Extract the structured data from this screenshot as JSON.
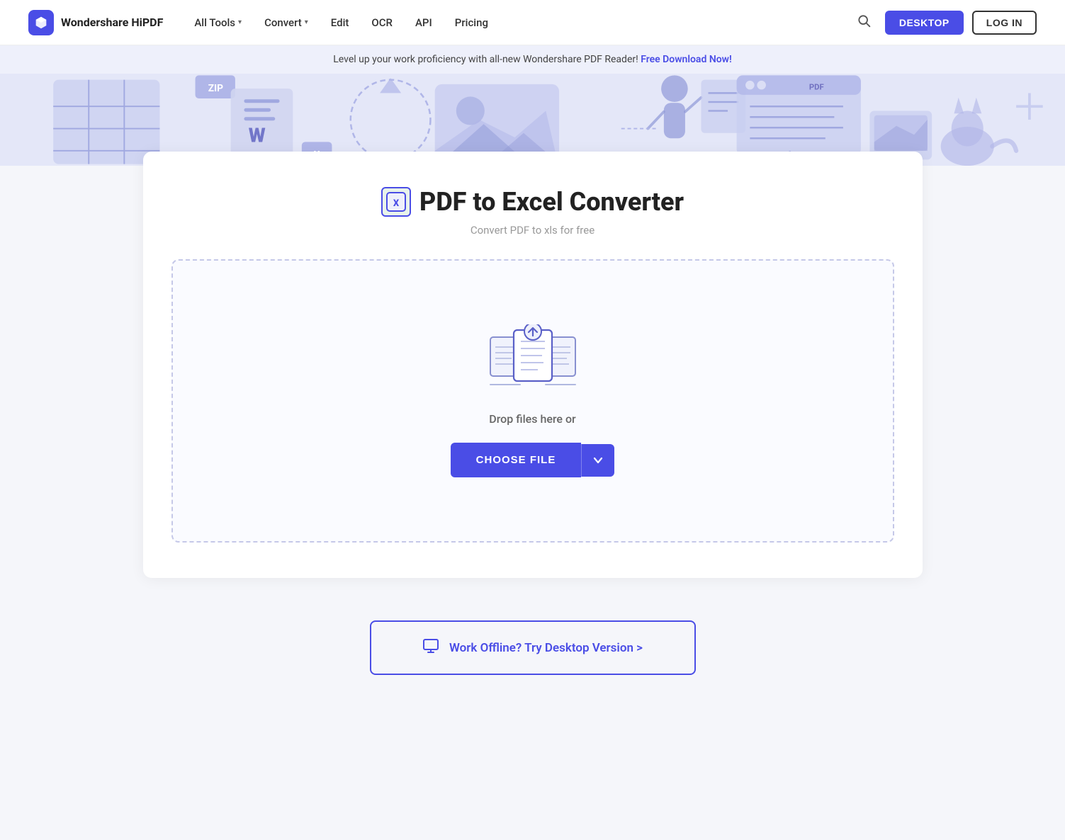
{
  "brand": {
    "name": "Wondershare HiPDF",
    "logo_alt": "HiPDF logo"
  },
  "navbar": {
    "all_tools": "All Tools",
    "convert": "Convert",
    "edit": "Edit",
    "ocr": "OCR",
    "api": "API",
    "pricing": "Pricing",
    "desktop_btn": "DESKTOP",
    "login_btn": "LOG IN"
  },
  "banner": {
    "text": "Level up your work proficiency with all-new Wondershare PDF Reader!",
    "link_text": "Free Download Now!"
  },
  "page": {
    "title": "PDF to Excel Converter",
    "subtitle": "Convert PDF to xls for free"
  },
  "upload": {
    "drop_text": "Drop files here or",
    "choose_file_btn": "CHOOSE FILE"
  },
  "offline": {
    "text": "Work Offline? Try Desktop Version >"
  }
}
